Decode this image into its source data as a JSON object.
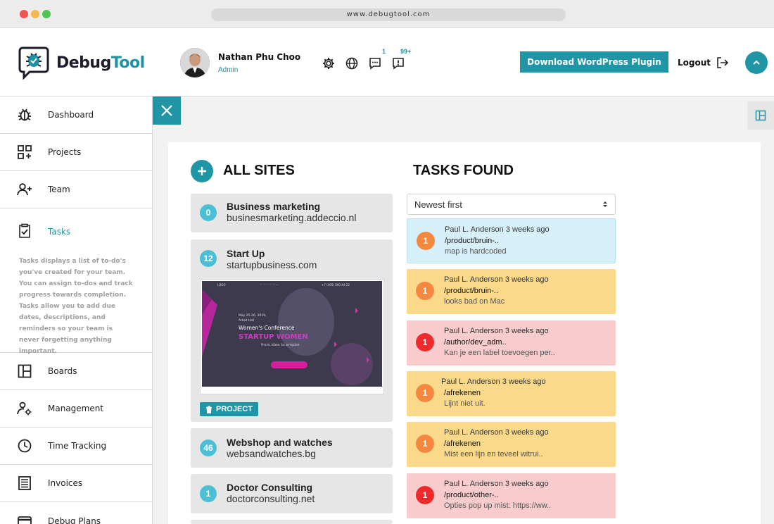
{
  "browser": {
    "url": "www.debugtool.com"
  },
  "header": {
    "brand_part1": "Debug",
    "brand_part2": "Tool",
    "user_name": "Nathan Phu Choo",
    "user_role": "Admin",
    "chat_badge": "1",
    "notifications_badge": "99+",
    "download_label": "Download WordPress Plugin",
    "logout_label": "Logout"
  },
  "sidebar": {
    "items": [
      {
        "label": "Dashboard",
        "icon": "bug-icon"
      },
      {
        "label": "Projects",
        "icon": "projects-grid-icon"
      },
      {
        "label": "Team",
        "icon": "add-user-icon"
      },
      {
        "label": "Tasks",
        "icon": "clipboard-check-icon"
      },
      {
        "label": "Boards",
        "icon": "board-layout-icon"
      },
      {
        "label": "Management",
        "icon": "user-gear-icon"
      },
      {
        "label": "Time Tracking",
        "icon": "clock-icon"
      },
      {
        "label": "Invoices",
        "icon": "invoice-icon"
      },
      {
        "label": "Debug Plans",
        "icon": "card-icon"
      }
    ],
    "tasks_description": "Tasks displays a list of to-do's you've created for your team. You can assign to-dos and track progress towards completion. Tasks allow you to add due dates, descriptions, and reminders so your team is never forgetting anything important."
  },
  "sites": {
    "title": "ALL SITES",
    "items": [
      {
        "count": "0",
        "name": "Business marketing",
        "url": "businesmarketing.addeccio.nl"
      },
      {
        "count": "12",
        "name": "Start Up",
        "url": "startupbusiness.com"
      },
      {
        "count": "46",
        "name": "Webshop and watches",
        "url": "websandwatches.bg"
      },
      {
        "count": "1",
        "name": "Doctor Consulting",
        "url": "doctorconsulting.net"
      }
    ],
    "project_tag": "PROJECT",
    "preview": {
      "logo": "LOGO",
      "date": "May 25-26, 2019,",
      "venue": "Arbat Hall",
      "headline": "Women's Conference",
      "highlight": "STARTUP WOMEN",
      "tagline": "from idea to empire",
      "phone": "+7 (495) 000-44-22"
    }
  },
  "tasks": {
    "title": "TASKS FOUND",
    "sort_value": "Newest first",
    "items": [
      {
        "num": "1",
        "author": "Paul L. Anderson",
        "time": "3 weeks ago",
        "path": "/product/bruin-..",
        "desc": "map is hardcoded",
        "color": "blue"
      },
      {
        "num": "1",
        "author": "Paul L. Anderson",
        "time": "3 weeks ago",
        "path": "/product/bruin-..",
        "desc": "looks bad on Mac",
        "color": "yellow"
      },
      {
        "num": "1",
        "author": "Paul L. Anderson",
        "time": "3 weeks ago",
        "path": "/author/dev_adm..",
        "desc": "Kan je een label toevoegen per..",
        "color": "red"
      },
      {
        "num": "1",
        "author": "Paul L. Anderson",
        "time": "3 weeks ago",
        "path": "/afrekenen",
        "desc": "Lijnt niet uit.",
        "color": "yellow"
      },
      {
        "num": "1",
        "author": "Paul L. Anderson",
        "time": "3 weeks ago",
        "path": "/afrekenen",
        "desc": "Mist een lijn en teveel witrui..",
        "color": "yellow"
      },
      {
        "num": "1",
        "author": "Paul L. Anderson",
        "time": "3 weeks ago",
        "path": "/product/other-..",
        "desc": "Opties pop up mist: https://ww..",
        "color": "red"
      }
    ]
  },
  "colors": {
    "accent": "#1f95a5",
    "count_badge": "#4bbfd6",
    "task_blue": "#d7effa",
    "task_yellow": "#fbd98a",
    "task_red": "#f8cccd",
    "badge_orange": "#f4883f",
    "badge_red": "#ee2a2a"
  }
}
